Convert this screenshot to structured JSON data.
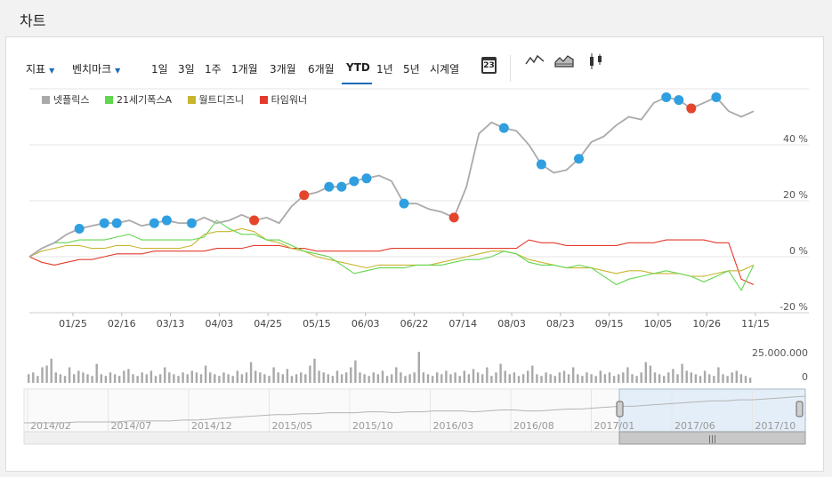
{
  "page": {
    "title": "차트"
  },
  "toolbar": {
    "indicator": "지표",
    "benchmark": "벤치마크",
    "ranges": [
      "1일",
      "3일",
      "1주",
      "1개월",
      "3개월",
      "6개월",
      "YTD",
      "1년",
      "5년",
      "시계열"
    ],
    "active_range": "YTD",
    "calendar_day": "23",
    "chart_type_icons": [
      "line-chart-icon",
      "area-chart-icon",
      "candlestick-icon"
    ]
  },
  "chart_data": {
    "type": "line",
    "legend": [
      {
        "name": "넷플릭스",
        "color": "#aaaaaa"
      },
      {
        "name": "21세기폭스A",
        "color": "#62d64e"
      },
      {
        "name": "월트디즈니",
        "color": "#c8b530"
      },
      {
        "name": "타임워너",
        "color": "#e23b2b"
      }
    ],
    "x_ticks": [
      "01/25",
      "02/16",
      "03/13",
      "04/03",
      "04/25",
      "05/15",
      "06/03",
      "06/22",
      "07/14",
      "08/03",
      "08/23",
      "09/15",
      "10/05",
      "10/26",
      "11/15"
    ],
    "y_ticks": [
      "40 %",
      "20 %",
      "0 %",
      "-20 %"
    ],
    "y_unit": "%",
    "ylim": [
      -20,
      60
    ],
    "series": [
      {
        "name": "넷플릭스",
        "color": "#aaaaaa",
        "values": [
          0,
          3,
          5,
          8,
          10,
          11,
          12,
          12,
          13,
          11,
          12,
          13,
          12,
          12,
          14,
          12,
          13,
          15,
          13,
          14,
          12,
          18,
          22,
          23,
          25,
          25,
          27,
          28,
          29,
          27,
          19,
          19,
          17,
          16,
          14,
          25,
          44,
          48,
          46,
          45,
          40,
          33,
          30,
          31,
          35,
          41,
          43,
          47,
          50,
          49,
          55,
          57,
          56,
          53,
          55,
          57,
          52,
          50,
          52
        ]
      },
      {
        "name": "21세기폭스A",
        "color": "#62d64e",
        "values": [
          0,
          3,
          5,
          5,
          6,
          6,
          6,
          7,
          8,
          6,
          6,
          6,
          6,
          6,
          7,
          13,
          10,
          8,
          8,
          6,
          6,
          4,
          2,
          1,
          0,
          -3,
          -6,
          -5,
          -4,
          -4,
          -4,
          -3,
          -3,
          -3,
          -2,
          -1,
          -1,
          0,
          2,
          1,
          -2,
          -3,
          -3,
          -4,
          -3,
          -4,
          -7,
          -10,
          -8,
          -7,
          -6,
          -5,
          -6,
          -7,
          -9,
          -7,
          -5,
          -12,
          -3
        ]
      },
      {
        "name": "월트디즈니",
        "color": "#c8b530",
        "values": [
          0,
          2,
          3,
          4,
          4,
          3,
          3,
          4,
          4,
          3,
          3,
          3,
          3,
          4,
          8,
          9,
          9,
          10,
          9,
          6,
          5,
          3,
          2,
          0,
          -1,
          -2,
          -3,
          -4,
          -3,
          -3,
          -3,
          -3,
          -3,
          -2,
          -1,
          0,
          1,
          2,
          2,
          1,
          -1,
          -2,
          -3,
          -4,
          -4,
          -4,
          -5,
          -6,
          -5,
          -5,
          -6,
          -6,
          -6,
          -7,
          -7,
          -6,
          -5,
          -5,
          -3
        ]
      },
      {
        "name": "타임워너",
        "color": "#e23b2b",
        "values": [
          0,
          -2,
          -3,
          -2,
          -1,
          -1,
          0,
          1,
          1,
          1,
          2,
          2,
          2,
          2,
          2,
          3,
          3,
          3,
          4,
          4,
          4,
          3,
          3,
          2,
          2,
          2,
          2,
          2,
          2,
          3,
          3,
          3,
          3,
          3,
          3,
          3,
          3,
          3,
          3,
          3,
          6,
          5,
          5,
          4,
          4,
          4,
          4,
          4,
          5,
          5,
          5,
          6,
          6,
          6,
          6,
          5,
          5,
          -8,
          -10
        ]
      }
    ],
    "markers": [
      {
        "series": "넷플릭스",
        "i": 4,
        "color": "blue"
      },
      {
        "series": "넷플릭스",
        "i": 6,
        "color": "blue"
      },
      {
        "series": "넷플릭스",
        "i": 7,
        "color": "blue"
      },
      {
        "series": "넷플릭스",
        "i": 10,
        "color": "blue"
      },
      {
        "series": "넷플릭스",
        "i": 11,
        "color": "blue"
      },
      {
        "series": "넷플릭스",
        "i": 13,
        "color": "blue"
      },
      {
        "series": "넷플릭스",
        "i": 18,
        "color": "red"
      },
      {
        "series": "넷플릭스",
        "i": 22,
        "color": "red"
      },
      {
        "series": "넷플릭스",
        "i": 24,
        "color": "blue"
      },
      {
        "series": "넷플릭스",
        "i": 25,
        "color": "blue"
      },
      {
        "series": "넷플릭스",
        "i": 26,
        "color": "blue"
      },
      {
        "series": "넷플릭스",
        "i": 27,
        "color": "blue"
      },
      {
        "series": "넷플릭스",
        "i": 30,
        "color": "blue"
      },
      {
        "series": "넷플릭스",
        "i": 34,
        "color": "red"
      },
      {
        "series": "넷플릭스",
        "i": 38,
        "color": "blue"
      },
      {
        "series": "넷플릭스",
        "i": 41,
        "color": "blue"
      },
      {
        "series": "넷플릭스",
        "i": 44,
        "color": "blue"
      },
      {
        "series": "넷플릭스",
        "i": 51,
        "color": "blue"
      },
      {
        "series": "넷플릭스",
        "i": 52,
        "color": "blue"
      },
      {
        "series": "넷플릭스",
        "i": 53,
        "color": "red"
      },
      {
        "series": "넷플릭스",
        "i": 55,
        "color": "blue"
      }
    ],
    "volume": {
      "max_label": "25.000.000",
      "min_label": "0",
      "values": [
        5,
        6,
        4,
        9,
        10,
        14,
        6,
        5,
        4,
        9,
        5,
        7,
        6,
        5,
        4,
        11,
        5,
        4,
        6,
        5,
        4,
        7,
        8,
        5,
        4,
        6,
        5,
        7,
        4,
        5,
        9,
        6,
        5,
        4,
        6,
        5,
        7,
        6,
        5,
        10,
        6,
        5,
        4,
        6,
        5,
        4,
        7,
        5,
        6,
        12,
        7,
        6,
        5,
        4,
        9,
        6,
        5,
        8,
        4,
        5,
        6,
        5,
        10,
        14,
        7,
        6,
        5,
        4,
        7,
        5,
        6,
        9,
        13,
        6,
        5,
        4,
        6,
        5,
        7,
        4,
        5,
        9,
        6,
        4,
        5,
        6,
        18,
        6,
        5,
        4,
        6,
        5,
        7,
        5,
        6,
        4,
        7,
        5,
        8,
        6,
        5,
        9,
        4,
        6,
        11,
        7,
        5,
        6,
        4,
        5,
        7,
        10,
        5,
        4,
        6,
        5,
        4,
        6,
        7,
        5,
        9,
        5,
        4,
        6,
        5,
        4,
        7,
        5,
        6,
        4,
        5,
        6,
        9,
        5,
        4,
        6,
        12,
        10,
        6,
        5,
        4,
        6,
        8,
        5,
        11,
        7,
        6,
        5,
        4,
        7,
        5,
        4,
        9,
        5,
        4,
        6,
        7,
        5,
        4,
        3
      ]
    },
    "navigator": {
      "labels": [
        "2014/02",
        "2014/07",
        "2014/12",
        "2015/05",
        "2015/10",
        "2016/03",
        "2016/08",
        "2017/01",
        "2017/06",
        "2017/10"
      ],
      "values": [
        3,
        3,
        3,
        3,
        4,
        4,
        4,
        4,
        5,
        5,
        5,
        5,
        6,
        6,
        7,
        8,
        9,
        10,
        11,
        12,
        12,
        13,
        13,
        14,
        14,
        14,
        15,
        15,
        14,
        15,
        15,
        16,
        16,
        16,
        15,
        16,
        17,
        17,
        16,
        16,
        17,
        18,
        18,
        19,
        20,
        21,
        21,
        22,
        23,
        24,
        25,
        26,
        27,
        27,
        28,
        28,
        29,
        30,
        31,
        32
      ],
      "selected_from": "2017/01",
      "selected_to": "2017/10",
      "scroll_grip": "|||"
    }
  }
}
